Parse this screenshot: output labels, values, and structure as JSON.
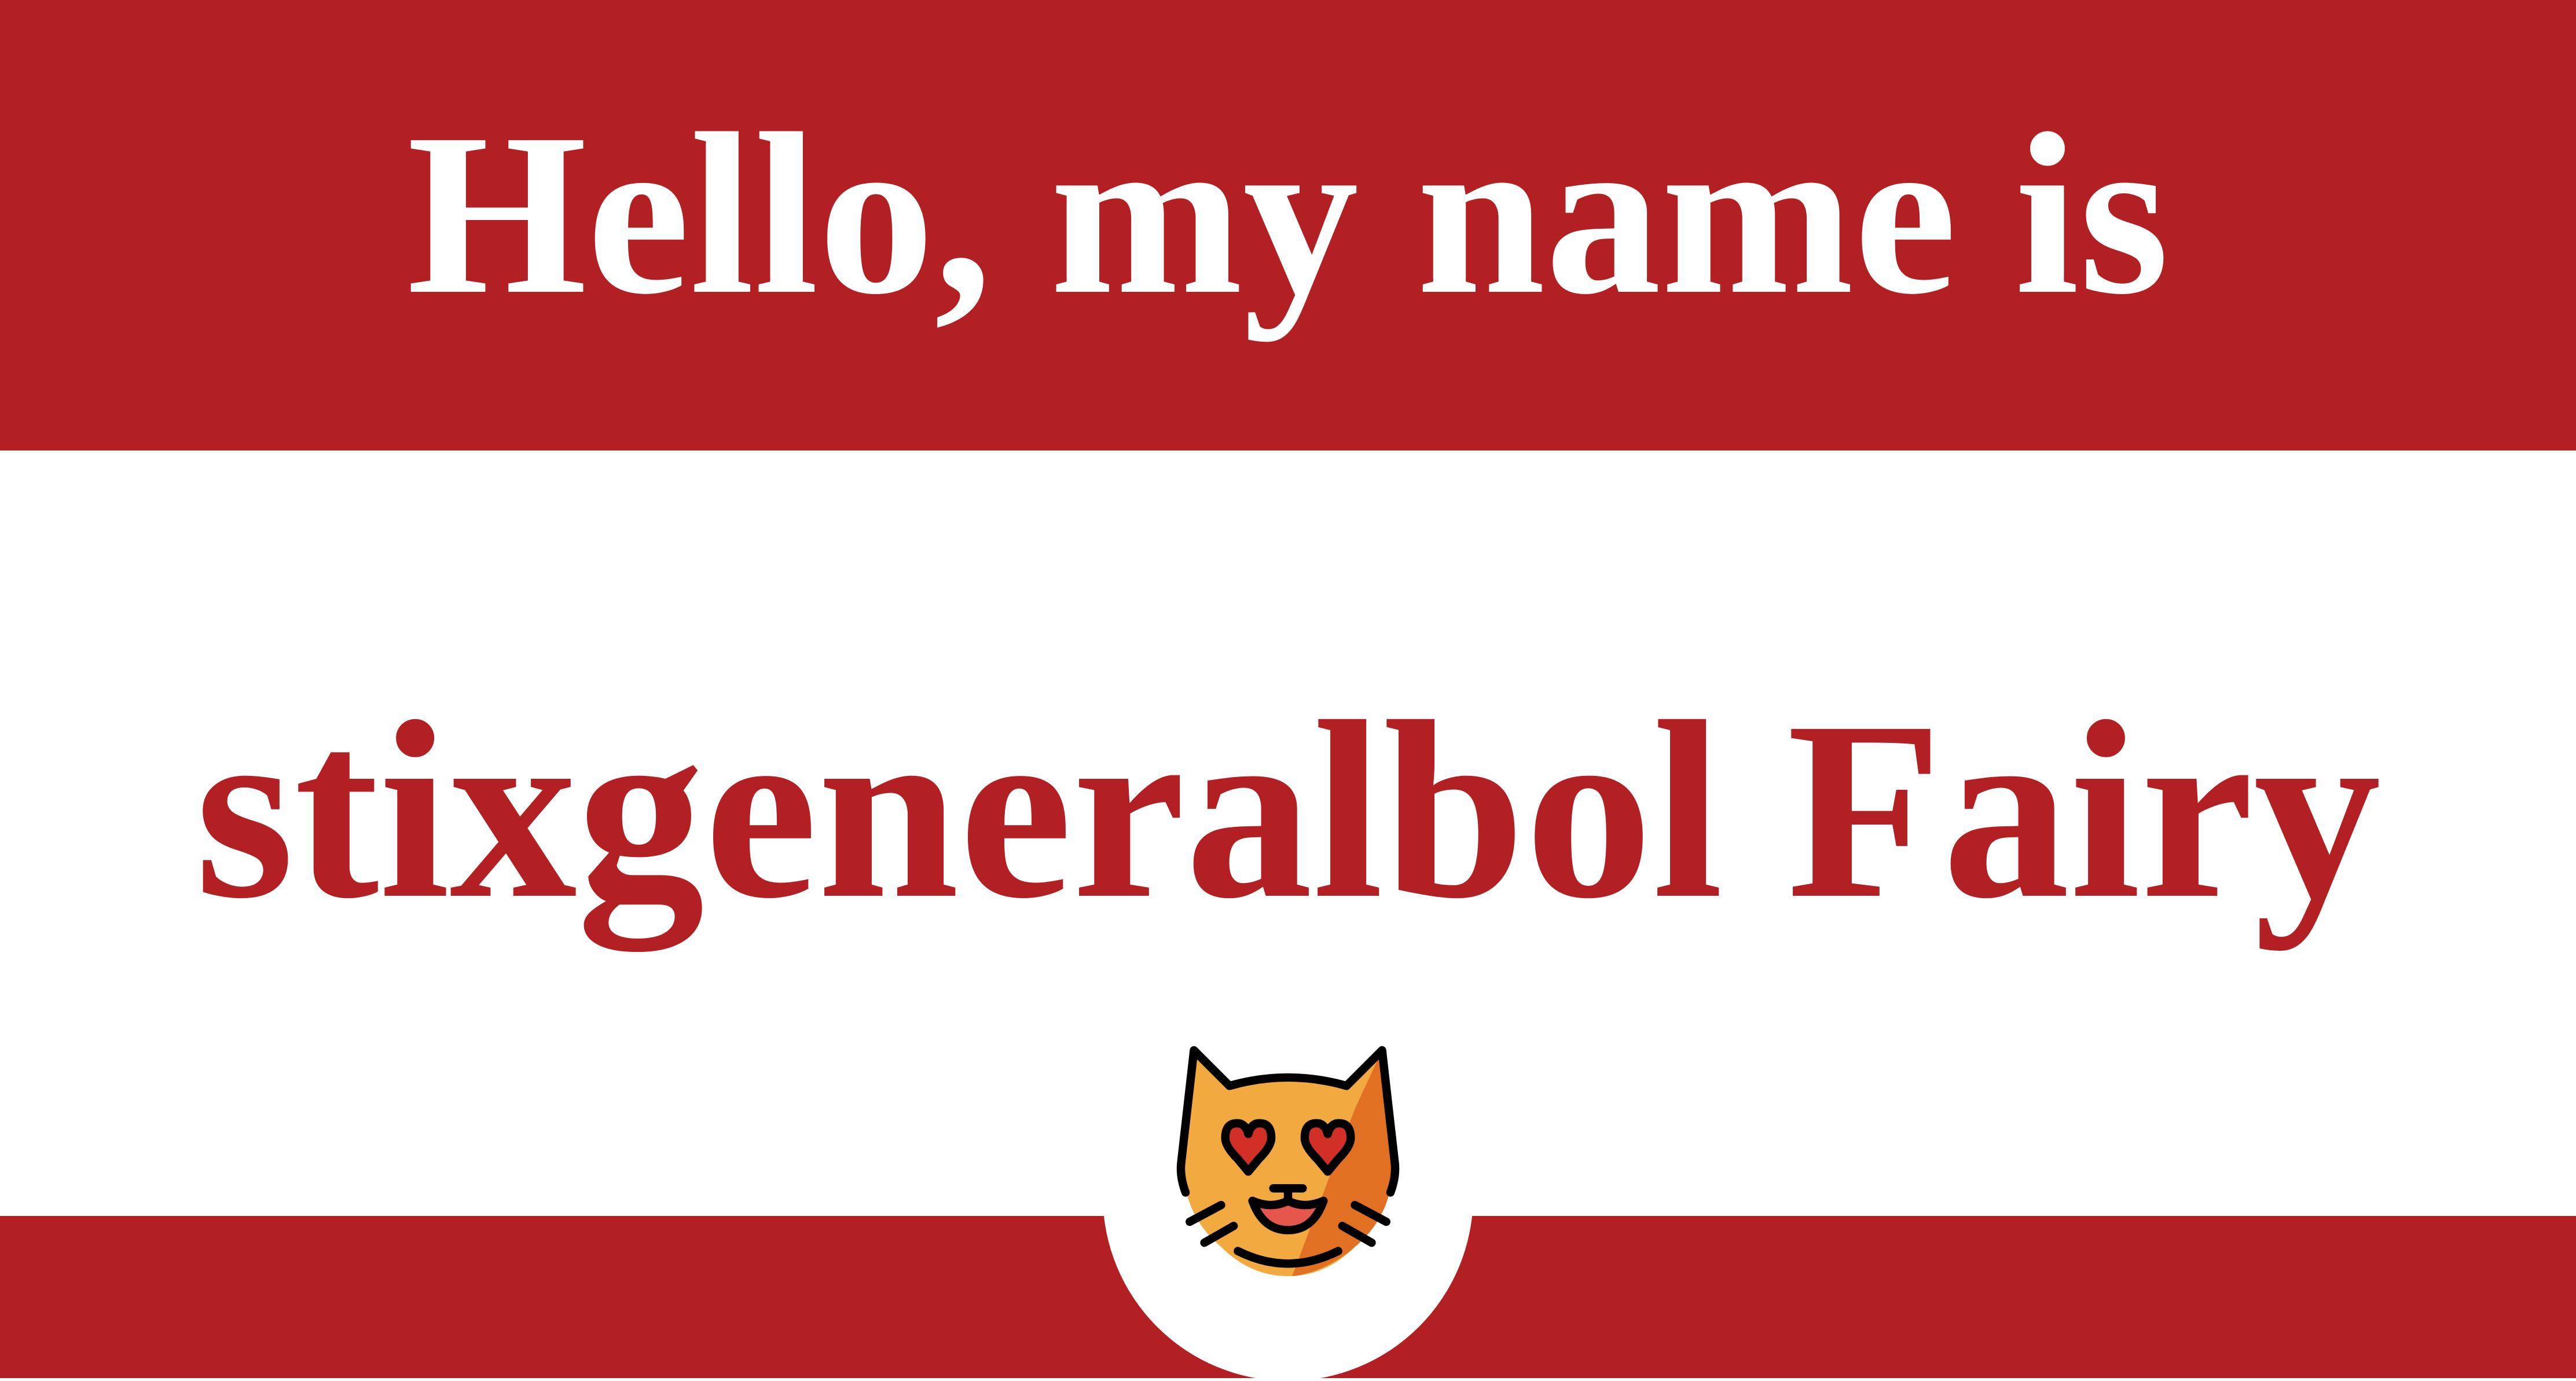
{
  "header": {
    "greeting": "Hello, my name is"
  },
  "name": {
    "text": "stixgeneralbol Fairy"
  },
  "badge": {
    "icon": "smiling-cat-heart-eyes-icon"
  },
  "colors": {
    "band": "#b22024",
    "name_text": "#b22024",
    "greeting_text": "#ffffff",
    "background": "#ffffff",
    "cat_fur": "#f2a940",
    "cat_shade": "#e27022",
    "cat_heart": "#d22f27",
    "cat_mouth": "#e5564d"
  }
}
